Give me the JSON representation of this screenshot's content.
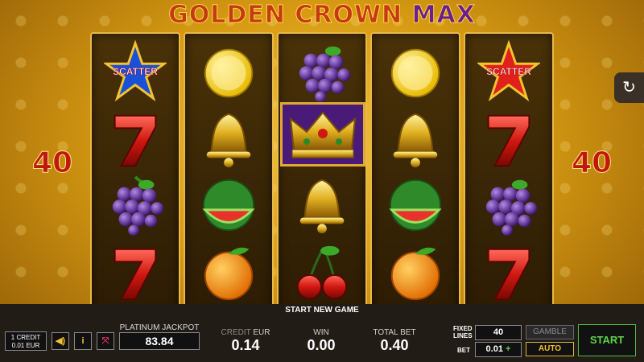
{
  "game": {
    "title_part1": "GOLDEN CROWN",
    "title_part2": "MAX",
    "win_left": "40",
    "win_right": "40",
    "history_icon": "history-icon"
  },
  "reels": [
    {
      "symbols": [
        "scatter-star",
        "red-seven",
        "grapes",
        "red-seven"
      ],
      "scatter_label": "SCATTER"
    },
    {
      "symbols": [
        "lemon",
        "golden-bell",
        "watermelon",
        "orange"
      ]
    },
    {
      "symbols": [
        "grapes",
        "golden-crown",
        "golden-bell",
        "cherries"
      ]
    },
    {
      "symbols": [
        "lemon",
        "golden-bell",
        "watermelon",
        "orange"
      ]
    },
    {
      "symbols": [
        "scatter-star",
        "red-seven",
        "grapes",
        "red-seven"
      ],
      "scatter_label": "SCATTER"
    }
  ],
  "bottom": {
    "status_text": "START NEW GAME",
    "credit_denom_line1": "1 CREDIT",
    "credit_denom_line2": "0.01 EUR",
    "sound_icon": "speaker-icon",
    "info_label": "i",
    "fullscreen_icon": "fullscreen-icon",
    "jackpot_label": "PLATINUM JACKPOT",
    "jackpot_value": "83.84",
    "credit_label": "CREDIT",
    "credit_currency": "EUR",
    "credit_value": "0.14",
    "win_label": "WIN",
    "win_value": "0.00",
    "total_bet_label": "TOTAL BET",
    "total_bet_value": "0.40",
    "fixed_lines_label_1": "FIXED",
    "fixed_lines_label_2": "LINES",
    "fixed_lines_value": "40",
    "bet_label": "BET",
    "bet_value": "0.01",
    "bet_plus": "+",
    "gamble_label": "GAMBLE",
    "auto_label": "AUTO",
    "start_label": "START"
  },
  "colors": {
    "accent_green": "#5fd34a",
    "accent_gold": "#f3c430",
    "win_red": "#c0180e"
  }
}
